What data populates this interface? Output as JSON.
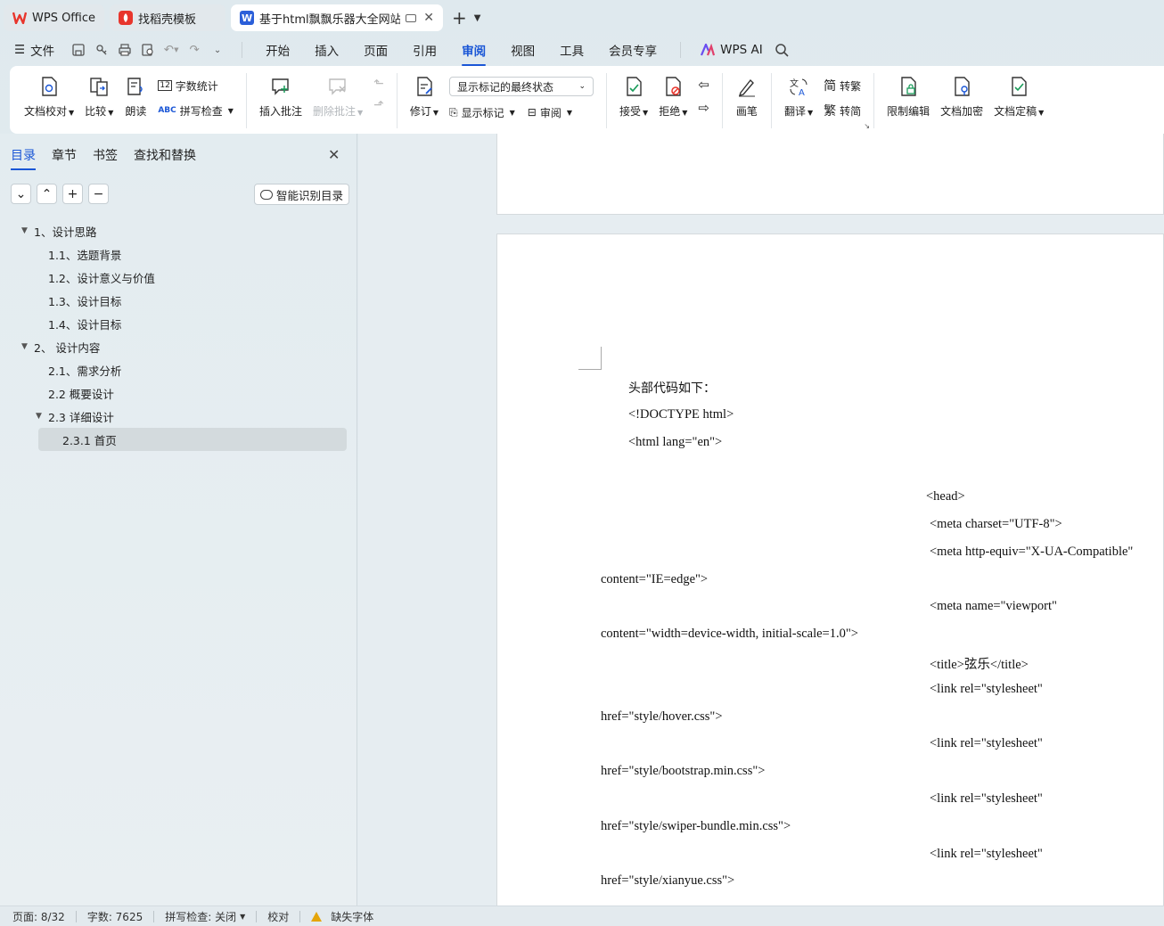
{
  "tabs": [
    {
      "label": "WPS Office",
      "logo": "wps-logo"
    },
    {
      "label": "找稻壳模板",
      "logo": "docer-logo"
    },
    {
      "label": "基于html飘飘乐器大全网站的",
      "logo": "word-logo",
      "active": true
    }
  ],
  "menubar": {
    "file_label": "文件",
    "items": [
      "开始",
      "插入",
      "页面",
      "引用",
      "审阅",
      "视图",
      "工具",
      "会员专享"
    ],
    "active": "审阅",
    "ai_label": "WPS AI"
  },
  "ribbon": {
    "doc_check": "文档校对",
    "compare": "比较",
    "read_aloud": "朗读",
    "word_count": "字数统计",
    "spell_check": "拼写检查",
    "insert_comment": "插入批注",
    "delete_comment": "删除批注",
    "revise": "修订",
    "markup_state": "显示标记的最终状态",
    "show_markup": "显示标记",
    "review": "审阅",
    "accept": "接受",
    "reject": "拒绝",
    "pen": "画笔",
    "translate": "翻译",
    "to_traditional": "转繁",
    "to_simplified": "转简",
    "restrict_edit": "限制编辑",
    "encrypt": "文档加密",
    "finalize": "文档定稿"
  },
  "nav": {
    "tabs": [
      "目录",
      "章节",
      "书签",
      "查找和替换"
    ],
    "smart_toc": "智能识别目录",
    "toc": [
      {
        "text": "1、设计思路",
        "level": 1,
        "expanded": true
      },
      {
        "text": "1.1、选题背景",
        "level": 2
      },
      {
        "text": "1.2、设计意义与价值",
        "level": 2
      },
      {
        "text": "1.3、设计目标",
        "level": 2
      },
      {
        "text": "1.4、设计目标",
        "level": 2
      },
      {
        "text": "2、 设计内容",
        "level": 1,
        "expanded": true
      },
      {
        "text": "2.1、需求分析",
        "level": 2
      },
      {
        "text": "2.2 概要设计",
        "level": 2
      },
      {
        "text": "2.3 详细设计",
        "level": 2,
        "expanded": true
      },
      {
        "text": "2.3.1 首页",
        "level": 3,
        "selected": true
      }
    ]
  },
  "document": {
    "lines": [
      "头部代码如下：",
      "<!DOCTYPE html>",
      "<html lang=\"en\">",
      "<head>",
      "<meta charset=\"UTF-8\">",
      "<meta http-equiv=\"X-UA-Compatible\"",
      "content=\"IE=edge\">",
      "<meta name=\"viewport\"",
      "content=\"width=device-width, initial-scale=1.0\">",
      "<title>弦乐</title>",
      "<link rel=\"stylesheet\"",
      "href=\"style/hover.css\">",
      "<link rel=\"stylesheet\"",
      "href=\"style/bootstrap.min.css\">",
      "<link rel=\"stylesheet\"",
      "href=\"style/swiper-bundle.min.css\">",
      "<link rel=\"stylesheet\"",
      "href=\"style/xianyue.css\">"
    ]
  },
  "status": {
    "page": "页面: 8/32",
    "words": "字数: 7625",
    "spell": "拼写检查: 关闭",
    "proof": "校对",
    "missing_font": "缺失字体"
  },
  "colors": {
    "accent": "#1a56d6",
    "wps_red": "#e8352c",
    "word_blue": "#2b5fd9"
  }
}
